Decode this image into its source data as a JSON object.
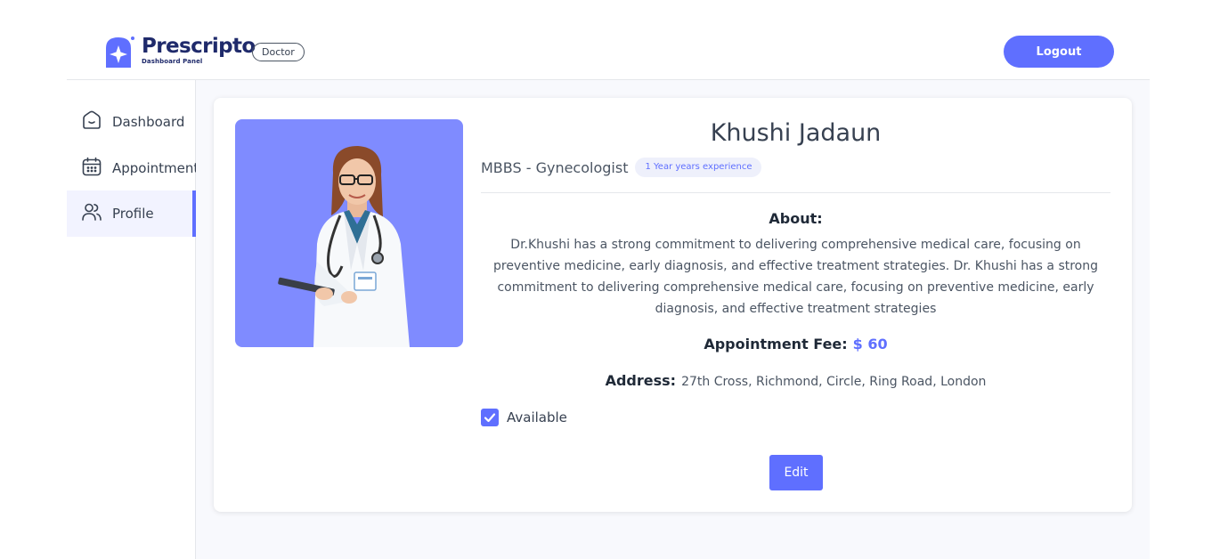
{
  "brand": {
    "name": "Prescripto",
    "subtitle": "Dashboard Panel",
    "role": "Doctor"
  },
  "header": {
    "logout_label": "Logout"
  },
  "sidebar": {
    "items": [
      {
        "label": "Dashboard",
        "icon": "home-icon",
        "active": false
      },
      {
        "label": "Appointments",
        "icon": "calendar-icon",
        "active": false
      },
      {
        "label": "Profile",
        "icon": "people-icon",
        "active": true
      }
    ]
  },
  "profile": {
    "name": "Khushi Jadaun",
    "degree": "MBBS - Gynecologist",
    "experience": "1 Year years experience",
    "about_label": "About:",
    "about": "Dr.Khushi has a strong commitment to delivering comprehensive medical care, focusing on preventive medicine, early diagnosis, and effective treatment strategies. Dr. Khushi has a strong commitment to delivering comprehensive medical care, focusing on preventive medicine, early diagnosis, and effective treatment strategies",
    "fee_label": "Appointment Fee:",
    "fee_value": "$ 60",
    "address_label": "Address:",
    "address": "27th Cross, Richmond, Circle, Ring Road, London",
    "available_label": "Available",
    "available": true,
    "edit_label": "Edit"
  },
  "colors": {
    "accent": "#5f6fff",
    "photo_bg": "#7f8bff",
    "main_bg": "#f8f9fd"
  }
}
